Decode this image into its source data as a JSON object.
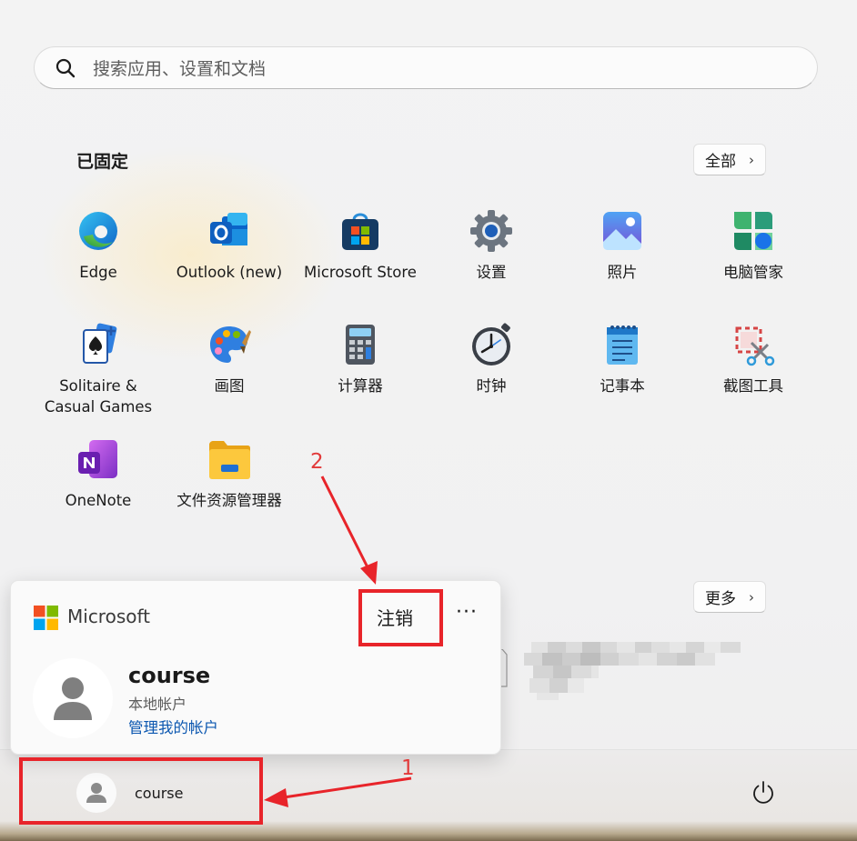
{
  "search": {
    "placeholder": "搜索应用、设置和文档"
  },
  "pinned": {
    "title": "已固定",
    "all_button": "全部",
    "apps": [
      {
        "name": "edge",
        "label": "Edge",
        "icon": "edge-icon"
      },
      {
        "name": "outlook",
        "label": "Outlook (new)",
        "icon": "outlook-icon"
      },
      {
        "name": "microsoft-store",
        "label": "Microsoft Store",
        "icon": "store-icon"
      },
      {
        "name": "settings",
        "label": "设置",
        "icon": "gear-icon"
      },
      {
        "name": "photos",
        "label": "照片",
        "icon": "photos-icon"
      },
      {
        "name": "pc-manager",
        "label": "电脑管家",
        "icon": "pc-manager-icon"
      },
      {
        "name": "solitaire",
        "label": "Solitaire & Casual Games",
        "icon": "cards-icon"
      },
      {
        "name": "paint",
        "label": "画图",
        "icon": "palette-icon"
      },
      {
        "name": "calculator",
        "label": "计算器",
        "icon": "calculator-icon"
      },
      {
        "name": "clock",
        "label": "时钟",
        "icon": "clock-icon"
      },
      {
        "name": "notepad",
        "label": "记事本",
        "icon": "notepad-icon"
      },
      {
        "name": "snipping-tool",
        "label": "截图工具",
        "icon": "scissors-icon"
      },
      {
        "name": "onenote",
        "label": "OneNote",
        "icon": "onenote-icon"
      },
      {
        "name": "file-explorer",
        "label": "文件资源管理器",
        "icon": "folder-icon"
      }
    ]
  },
  "recommended": {
    "more_button": "更多"
  },
  "account_card": {
    "brand": "Microsoft",
    "sign_out": "注销",
    "more": "···",
    "user_name": "course",
    "account_type": "本地帐户",
    "manage_link": "管理我的帐户"
  },
  "footer": {
    "user_name": "course",
    "power_icon": "power-icon"
  },
  "annotations": [
    {
      "label": "1",
      "color": "#e8242a"
    },
    {
      "label": "2",
      "color": "#e8242a"
    }
  ]
}
